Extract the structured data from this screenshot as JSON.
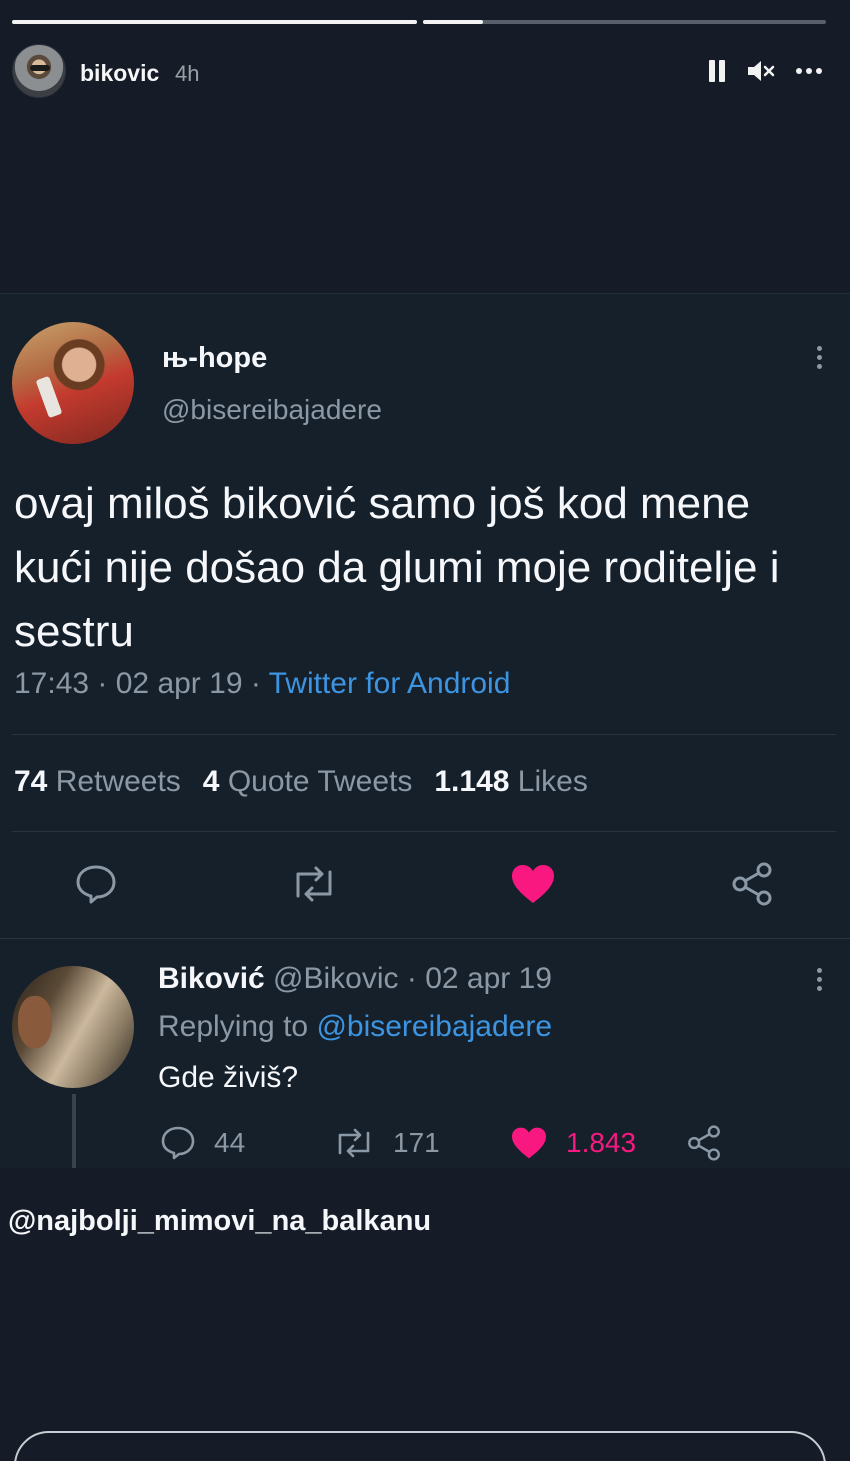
{
  "story": {
    "progress": [
      1.0,
      0.15
    ],
    "username": "bikovic",
    "time": "4h",
    "icons": {
      "pause": "pause-icon",
      "mute": "volume-muted-icon",
      "more": "more-horizontal-icon"
    }
  },
  "tweet": {
    "author_name": " њ-hope",
    "author_handle": "@bisereibajadere",
    "text": "ovaj miloš biković samo još kod mene kući nije došao da glumi moje roditelje i sestru",
    "timestamp": "17:43 · 02 apr 19 · ",
    "source": "Twitter for Android",
    "stats": {
      "retweets_count": "74",
      "retweets_label": "Retweets",
      "quotes_count": "4",
      "quotes_label": "Quote Tweets",
      "likes_count": "1.148",
      "likes_label": "Likes"
    },
    "actions": [
      "reply-icon",
      "retweet-icon",
      "heart-icon",
      "share-icon"
    ],
    "like_color": "#f91880"
  },
  "reply": {
    "name": "Biković",
    "handle_date": " @Bikovic · 02 apr 19",
    "replying_label": "Replying to ",
    "replying_to": "@bisereibajadere",
    "text": "Gde živiš?",
    "reply_count": "44",
    "retweet_count": "171",
    "like_count": "1.843"
  },
  "credit": "@najbolji_mimovi_na_balkanu",
  "colors": {
    "background": "#151c27",
    "link": "#3d94e0",
    "like": "#f91880",
    "muted": "#8b98a5"
  }
}
